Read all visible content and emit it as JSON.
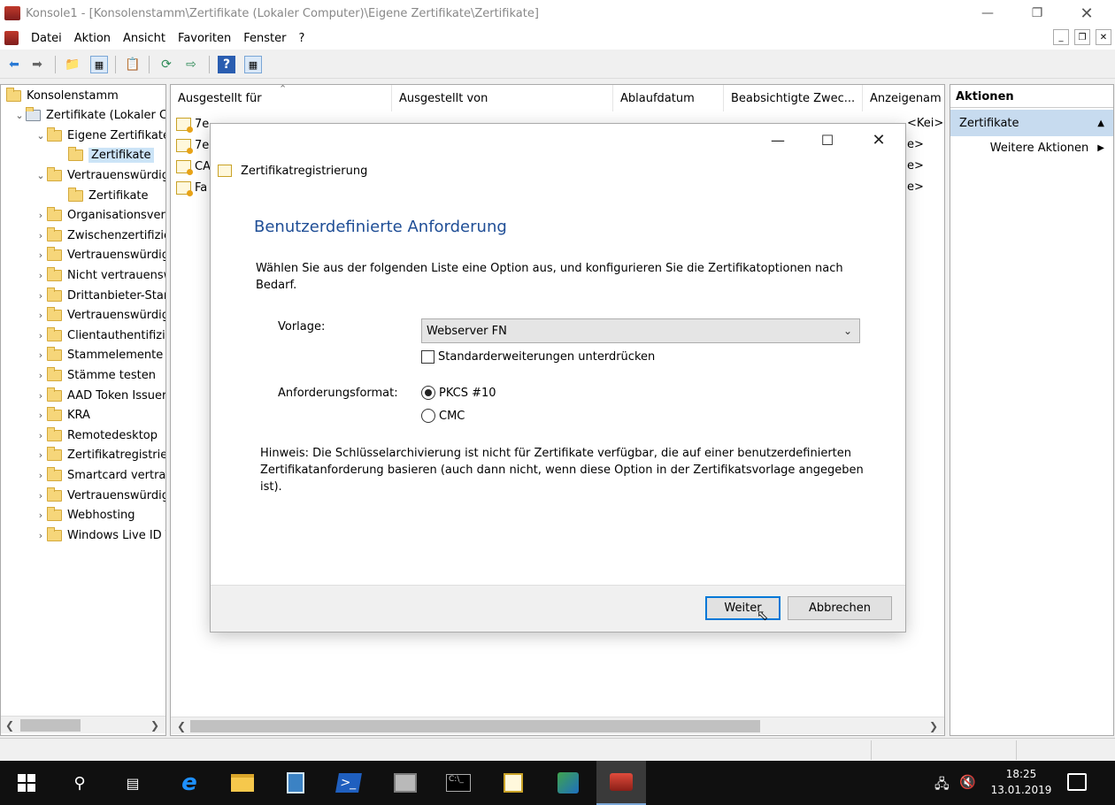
{
  "window": {
    "title": "Konsole1 - [Konsolenstamm\\Zertifikate (Lokaler Computer)\\Eigene Zertifikate\\Zertifikate]"
  },
  "menu": [
    "Datei",
    "Aktion",
    "Ansicht",
    "Favoriten",
    "Fenster",
    "?"
  ],
  "tree": [
    {
      "label": "Konsolenstamm",
      "level": 0,
      "chev": ""
    },
    {
      "label": "Zertifikate (Lokaler Computer)",
      "level": 1,
      "chev": "v"
    },
    {
      "label": "Eigene Zertifikate",
      "level": 2,
      "chev": "v"
    },
    {
      "label": "Zertifikate",
      "level": 3,
      "chev": "",
      "selected": true
    },
    {
      "label": "Vertrauenswürdige Stammzertifizierungsstellen",
      "level": 2,
      "chev": "v"
    },
    {
      "label": "Zertifikate",
      "level": 3,
      "chev": ""
    },
    {
      "label": "Organisationsvertrauen",
      "level": 2,
      "chev": ">"
    },
    {
      "label": "Zwischenzertifizierungsstellen",
      "level": 2,
      "chev": ">"
    },
    {
      "label": "Vertrauenswürdige Herausgeber",
      "level": 2,
      "chev": ">"
    },
    {
      "label": "Nicht vertrauenswürdige Zertifikate",
      "level": 2,
      "chev": ">"
    },
    {
      "label": "Drittanbieter-Stammzertifizierungsstellen",
      "level": 2,
      "chev": ">"
    },
    {
      "label": "Vertrauenswürdige Personen",
      "level": 2,
      "chev": ">"
    },
    {
      "label": "Clientauthentifizierungsaussteller",
      "level": 2,
      "chev": ">"
    },
    {
      "label": "Stammelemente testen",
      "level": 2,
      "chev": ">"
    },
    {
      "label": "Stämme testen",
      "level": 2,
      "chev": ">"
    },
    {
      "label": "AAD Token Issuer",
      "level": 2,
      "chev": ">"
    },
    {
      "label": "KRA",
      "level": 2,
      "chev": ">"
    },
    {
      "label": "Remotedesktop",
      "level": 2,
      "chev": ">"
    },
    {
      "label": "Zertifikatregistrierungsanforderungen",
      "level": 2,
      "chev": ">"
    },
    {
      "label": "Smartcard vertrauenswürdige Stämme",
      "level": 2,
      "chev": ">"
    },
    {
      "label": "Vertrauenswürdige Geräte",
      "level": 2,
      "chev": ">"
    },
    {
      "label": "Webhosting",
      "level": 2,
      "chev": ">"
    },
    {
      "label": "Windows Live ID Token Issuer",
      "level": 2,
      "chev": ">"
    }
  ],
  "columns": [
    "Ausgestellt für",
    "Ausgestellt von",
    "Ablaufdatum",
    "Beabsichtigte Zwec...",
    "Anzeigenam"
  ],
  "rows": [
    {
      "name": "7e",
      "right": "<Kei>"
    },
    {
      "name": "7e",
      "right": "e>"
    },
    {
      "name": "CA",
      "right": "e>"
    },
    {
      "name": "Fa",
      "right": "e>"
    }
  ],
  "actions": {
    "header": "Aktionen",
    "section": "Zertifikate",
    "more": "Weitere Aktionen"
  },
  "dialog": {
    "title": "Zertifikatregistrierung",
    "heading": "Benutzerdefinierte Anforderung",
    "intro": "Wählen Sie aus der folgenden Liste eine Option aus, und konfigurieren Sie die Zertifikatoptionen nach Bedarf.",
    "template_label": "Vorlage:",
    "template_value": "Webserver FN",
    "suppress_label": "Standarderweiterungen unterdrücken",
    "format_label": "Anforderungsformat:",
    "format_pkcs": "PKCS #10",
    "format_cmc": "CMC",
    "note": "Hinweis: Die Schlüsselarchivierung ist nicht für Zertifikate verfügbar, die auf einer benutzerdefinierten Zertifikatanforderung basieren (auch dann nicht, wenn diese Option in der Zertifikatsvorlage angegeben ist).",
    "next_button": "Weiter",
    "cancel_button": "Abbrechen"
  },
  "taskbar": {
    "time": "18:25",
    "date": "13.01.2019"
  }
}
